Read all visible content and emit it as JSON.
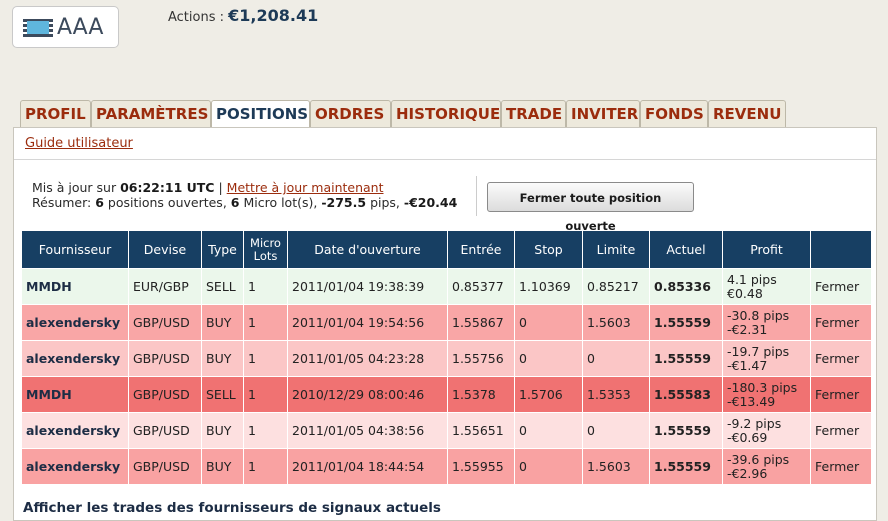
{
  "header": {
    "logo_text": "AAA",
    "actions_label": "Actions :",
    "actions_value": "€1,208.41"
  },
  "tabs": [
    {
      "label": "PROFIL"
    },
    {
      "label": "PARAMÈTRES"
    },
    {
      "label": "POSITIONS",
      "active": true
    },
    {
      "label": "ORDRES"
    },
    {
      "label": "HISTORIQUE"
    },
    {
      "label": "TRADE"
    },
    {
      "label": "INVITER"
    },
    {
      "label": "FONDS"
    },
    {
      "label": "REVENU"
    }
  ],
  "guide_label": "Guide utilisateur",
  "status": {
    "updated_prefix": "Mis à jour sur",
    "updated_time": "06:22:11 UTC",
    "sep": "|",
    "update_now": "Mettre à jour maintenant",
    "summary_prefix": "Résumer:",
    "open_count": "6",
    "open_label": "positions ouvertes,",
    "lots_count": "6",
    "lots_label": "Micro lot(s),",
    "pips_value": "-275.5",
    "pips_label": "pips,",
    "money_value": "-€20.44"
  },
  "close_all_label": "Fermer toute position ouverte",
  "table": {
    "headers": [
      "Fournisseur",
      "Devise",
      "Type",
      "Micro Lots",
      "Date d'ouverture",
      "Entrée",
      "Stop",
      "Limite",
      "Actuel",
      "Profit",
      ""
    ],
    "rows": [
      {
        "provider": "MMDH",
        "pair": "EUR/GBP",
        "type": "SELL",
        "lots": "1",
        "date": "2011/01/04 19:38:39",
        "entry": "0.85377",
        "stop": "1.10369",
        "limit": "0.85217",
        "current": "0.85336",
        "pips": "4.1 pips",
        "money": "€0.48",
        "action": "Fermer",
        "bg": "#ebf7eb"
      },
      {
        "provider": "alexendersky",
        "pair": "GBP/USD",
        "type": "BUY",
        "lots": "1",
        "date": "2011/01/04 19:54:56",
        "entry": "1.55867",
        "stop": "0",
        "limit": "1.5603",
        "current": "1.55559",
        "pips": "-30.8 pips",
        "money": "-€2.31",
        "action": "Fermer",
        "bg": "#f9a6a6"
      },
      {
        "provider": "alexendersky",
        "pair": "GBP/USD",
        "type": "BUY",
        "lots": "1",
        "date": "2011/01/05 04:23:28",
        "entry": "1.55756",
        "stop": "0",
        "limit": "0",
        "current": "1.55559",
        "pips": "-19.7 pips",
        "money": "-€1.47",
        "action": "Fermer",
        "bg": "#fbc6c6"
      },
      {
        "provider": "MMDH",
        "pair": "GBP/USD",
        "type": "SELL",
        "lots": "1",
        "date": "2010/12/29 08:00:46",
        "entry": "1.5378",
        "stop": "1.5706",
        "limit": "1.5353",
        "current": "1.55583",
        "pips": "-180.3 pips",
        "money": "-€13.49",
        "action": "Fermer",
        "bg": "#f07272"
      },
      {
        "provider": "alexendersky",
        "pair": "GBP/USD",
        "type": "BUY",
        "lots": "1",
        "date": "2011/01/05 04:38:56",
        "entry": "1.55651",
        "stop": "0",
        "limit": "0",
        "current": "1.55559",
        "pips": "-9.2 pips",
        "money": "-€0.69",
        "action": "Fermer",
        "bg": "#fde0e0"
      },
      {
        "provider": "alexendersky",
        "pair": "GBP/USD",
        "type": "BUY",
        "lots": "1",
        "date": "2011/01/04 18:44:54",
        "entry": "1.55955",
        "stop": "0",
        "limit": "1.5603",
        "current": "1.55559",
        "pips": "-39.6 pips",
        "money": "-€2.96",
        "action": "Fermer",
        "bg": "#f9a2a2"
      }
    ]
  },
  "footer_label": "Afficher les trades des fournisseurs de signaux actuels",
  "colors": {
    "header_bg": "#173f63",
    "tab_text": "#9b2c0d",
    "active_tab_text": "#1d3a57",
    "page_bg": "#efede6"
  }
}
